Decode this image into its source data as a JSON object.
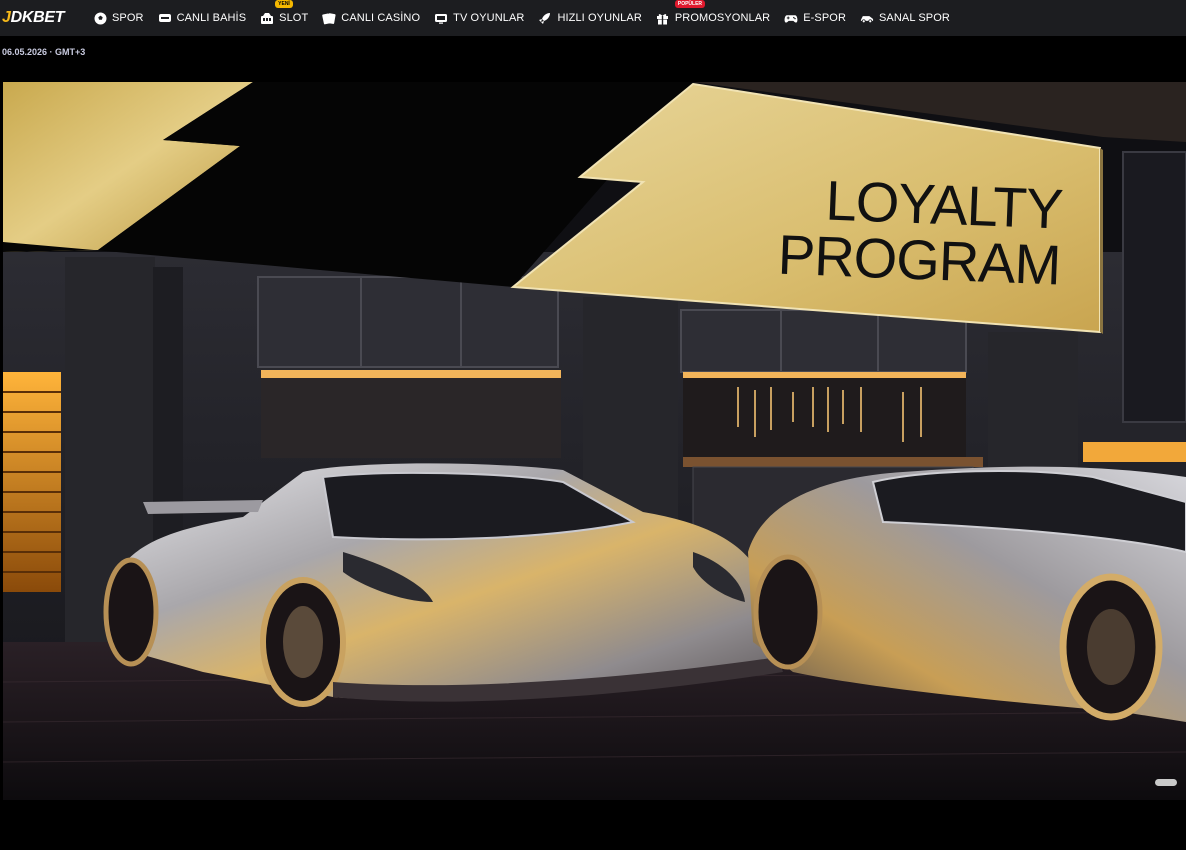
{
  "brand": {
    "part1": "J",
    "part2": "DKBET"
  },
  "nav": [
    {
      "icon": "soccer-ball-icon",
      "label": "SPOR"
    },
    {
      "icon": "live-bet-icon",
      "label": "CANLI BAHİS"
    },
    {
      "icon": "slot-machine-icon",
      "label": "SLOT",
      "badge": "YENİ"
    },
    {
      "icon": "cards-icon",
      "label": "CANLI CASİNO"
    },
    {
      "icon": "tv-icon",
      "label": "TV OYUNLAR"
    },
    {
      "icon": "rocket-icon",
      "label": "HIZLI OYUNLAR"
    },
    {
      "icon": "gift-icon",
      "label": "PROMOSYONLAR",
      "badge": "POPÜLER"
    },
    {
      "icon": "gamepad-icon",
      "label": "E-SPOR"
    },
    {
      "icon": "virtual-car-icon",
      "label": "SANAL SPOR"
    }
  ],
  "date_text": "06.05.2026 · GMT+3",
  "banner": {
    "line1": "LOYALTY",
    "line2": "PROGRAM"
  },
  "colors": {
    "accent": "#f6b91a",
    "nav_bg": "#1c1d20",
    "gold": "#d9bd6e",
    "new_badge": "#f5b800",
    "popular_badge": "#e0192d"
  }
}
